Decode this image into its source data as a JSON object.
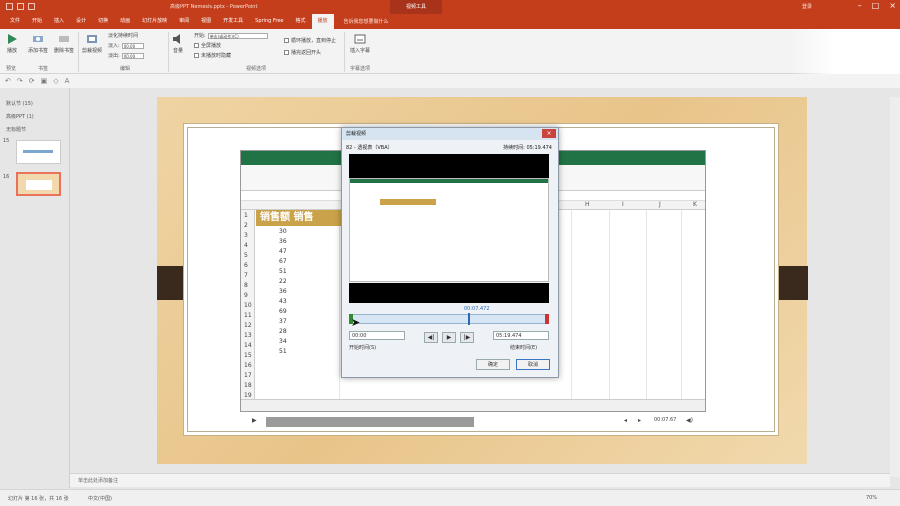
{
  "window": {
    "title": "高级PPT Nemesis.pptx - PowerPoint",
    "context_tab": "视频工具",
    "user": "登录"
  },
  "tabs": [
    "文件",
    "开始",
    "插入",
    "设计",
    "切换",
    "动画",
    "幻灯片放映",
    "审阅",
    "视图",
    "开发工具",
    "Spring Free",
    "格式",
    "播放"
  ],
  "active_tab": "播放",
  "tell_me": "告诉我您想要做什么",
  "ribbon": {
    "preview_label": "播放",
    "add_bookmark": "添加书签",
    "remove_bookmark": "删除书签",
    "trim_video": "剪裁视频",
    "fade_duration": "淡化持续时间",
    "fade_in": "淡入:",
    "fade_out": "淡出:",
    "fade_in_val": "00.00",
    "fade_out_val": "00.00",
    "volume": "音量",
    "start": "开始:",
    "start_val": "单击(或动作)(C)",
    "fullscreen": "全屏播放",
    "hide_not_playing": "未播放时隐藏",
    "loop": "循环播放，直到停止",
    "rewind": "播完返回开头",
    "insert_caption": "插入字幕",
    "group_preview": "预览",
    "group_bookmarks": "书签",
    "group_edit": "编辑",
    "group_video_options": "视频选项",
    "group_caption": "字幕选项"
  },
  "sidebar": {
    "sections": [
      "默认节 (15)",
      "高级PPT (1)",
      "无标题节"
    ],
    "slide_numbers": [
      "15",
      "16"
    ]
  },
  "excel_video": {
    "header_text": "销售额   销售",
    "col_letters": [
      "H",
      "I",
      "J",
      "K"
    ],
    "row_numbers": [
      "1",
      "2",
      "3",
      "4",
      "5",
      "6",
      "7",
      "8",
      "9",
      "10",
      "11",
      "12",
      "13",
      "14",
      "15",
      "16",
      "17",
      "18",
      "19"
    ],
    "values": [
      "30",
      "36",
      "47",
      "67",
      "51",
      "22",
      "36",
      "43",
      "69",
      "37",
      "28",
      "34",
      "51"
    ]
  },
  "player": {
    "time": "00:07.67"
  },
  "dialog": {
    "title": "剪裁视频",
    "file_name": "82 - 透视表（VBA）",
    "duration": "持续时间: 05:19.474",
    "marker_time": "00:07.472",
    "start_time": "00:00",
    "end_time": "05:19.474",
    "start_label": "开始时间(S)",
    "end_label": "结束时间(E)",
    "ok": "确定",
    "cancel": "取消"
  },
  "notes": "单击此处添加备注",
  "status": {
    "slide": "幻灯片 第 16 张，共 16 张",
    "lang": "中文(中国)",
    "zoom": "70%"
  }
}
